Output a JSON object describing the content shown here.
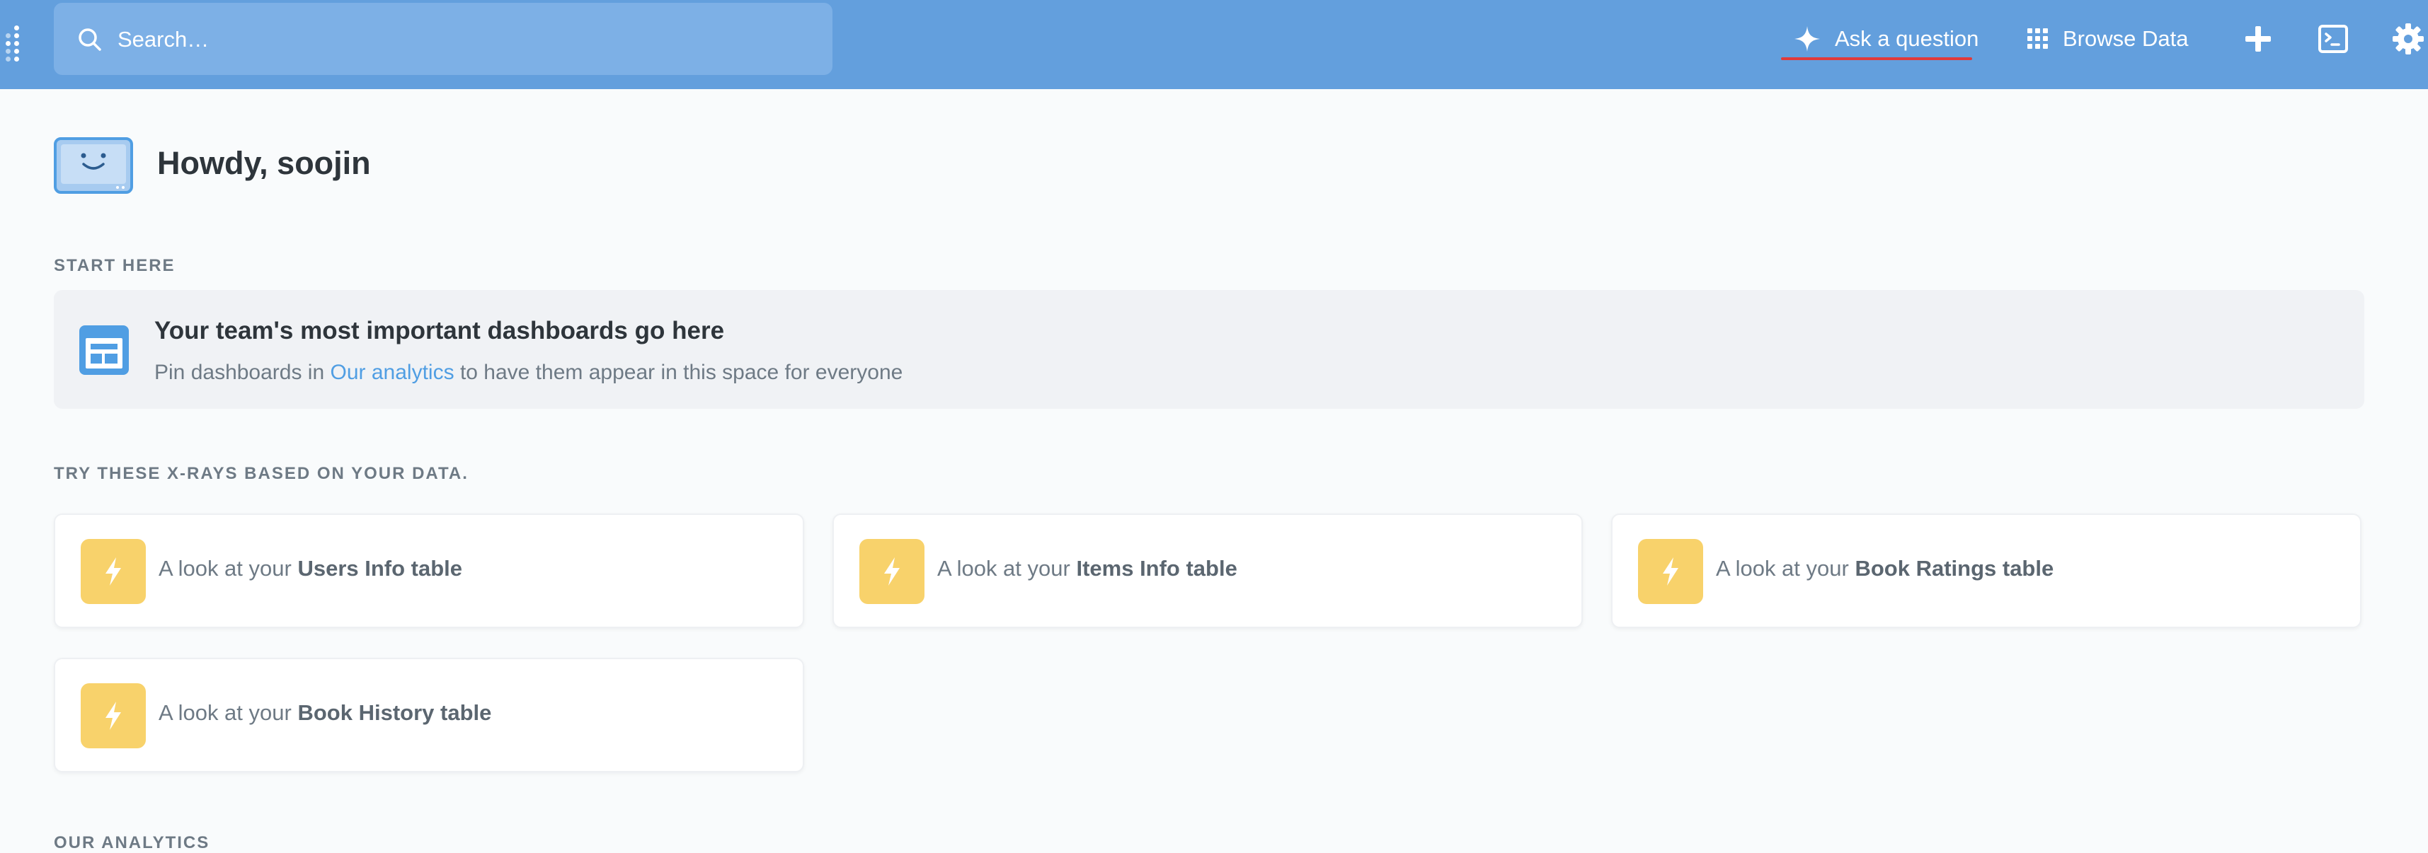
{
  "nav": {
    "search_placeholder": "Search…",
    "ask_label": "Ask a question",
    "browse_label": "Browse Data",
    "icons": {
      "logo": "metabase-logo-icon",
      "search": "search-icon",
      "ask": "sparkle-icon",
      "browse": "grid-icon",
      "new": "plus-icon",
      "sql": "terminal-icon",
      "settings": "gear-icon"
    }
  },
  "greeting": {
    "title": "Howdy, soojin",
    "icon": "happy-monitor-icon"
  },
  "start_here": {
    "label": "START HERE",
    "title": "Your team's most important dashboards go here",
    "body_prefix": "Pin dashboards in",
    "body_link": "Our analytics",
    "body_suffix": "to have them appear in this space for everyone",
    "icon": "dashboard-icon"
  },
  "xrays": {
    "label": "TRY THESE X-RAYS BASED ON YOUR DATA.",
    "prefix": "A look at your",
    "cards": [
      {
        "table": "Users Info table"
      },
      {
        "table": "Items Info table"
      },
      {
        "table": "Book Ratings table"
      },
      {
        "table": "Book History table"
      }
    ]
  },
  "next_section_label": "OUR ANALYTICS",
  "colors": {
    "nav_bg": "#639FDD",
    "accent": "#509EE3",
    "xray_icon_bg": "#F8D26B",
    "page_bg": "#F9FBFC",
    "ask_underline": "#E03A3A"
  }
}
